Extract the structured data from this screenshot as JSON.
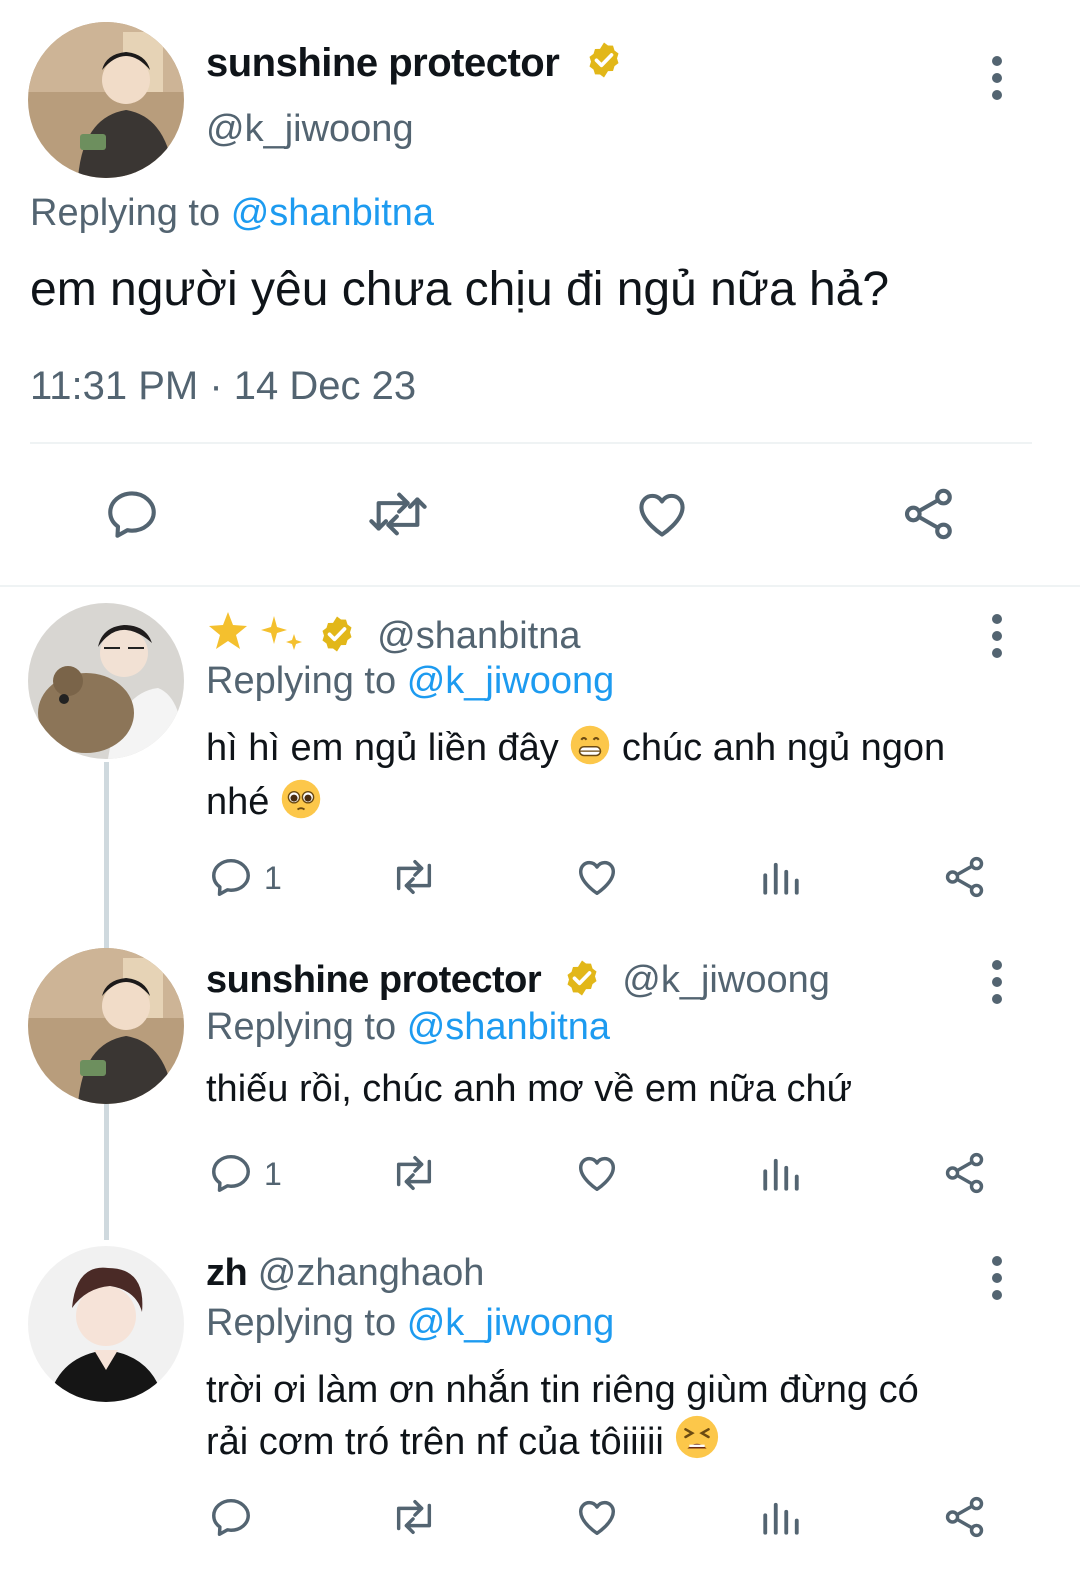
{
  "main_tweet": {
    "display_name": "sunshine protector",
    "handle": "@k_jiwoong",
    "replying_prefix": "Replying to",
    "replying_to": "@shanbitna",
    "text": "em người yêu chưa chịu đi ngủ nữa hả?",
    "timestamp": "11:31 PM · 14 Dec 23"
  },
  "replies": [
    {
      "display_name_emoji": "🌟✨",
      "handle": "@shanbitna",
      "replying_prefix": "Replying to",
      "replying_to": "@k_jiwoong",
      "text_part1": "hì hì em ngủ liền đây",
      "text_part2": "chúc anh ngủ ngon",
      "text_part3": "nhé",
      "reply_count": "1"
    },
    {
      "display_name": "sunshine protector",
      "handle": "@k_jiwoong",
      "replying_prefix": "Replying to",
      "replying_to": "@shanbitna",
      "text": "thiếu rồi, chúc anh mơ về em nữa chứ",
      "reply_count": "1"
    },
    {
      "display_name": "zh",
      "handle": "@zhanghaoh",
      "replying_prefix": "Replying to",
      "replying_to": "@k_jiwoong",
      "text_line1": "trời ơi làm ơn nhắn tin riêng giùm đừng có",
      "text_line2": "rải cơm tró trên nf của tôiiiii",
      "reply_count": ""
    }
  ],
  "icons": {
    "verified": "verified-badge-icon",
    "more": "more-vertical-icon",
    "reply": "reply-icon",
    "retweet": "retweet-icon",
    "like": "heart-icon",
    "views": "views-icon",
    "share": "share-icon"
  },
  "colors": {
    "mention": "#1d9bf0",
    "muted": "#536471",
    "verified_gold": "#e2b719",
    "divider": "#eff3f4"
  }
}
